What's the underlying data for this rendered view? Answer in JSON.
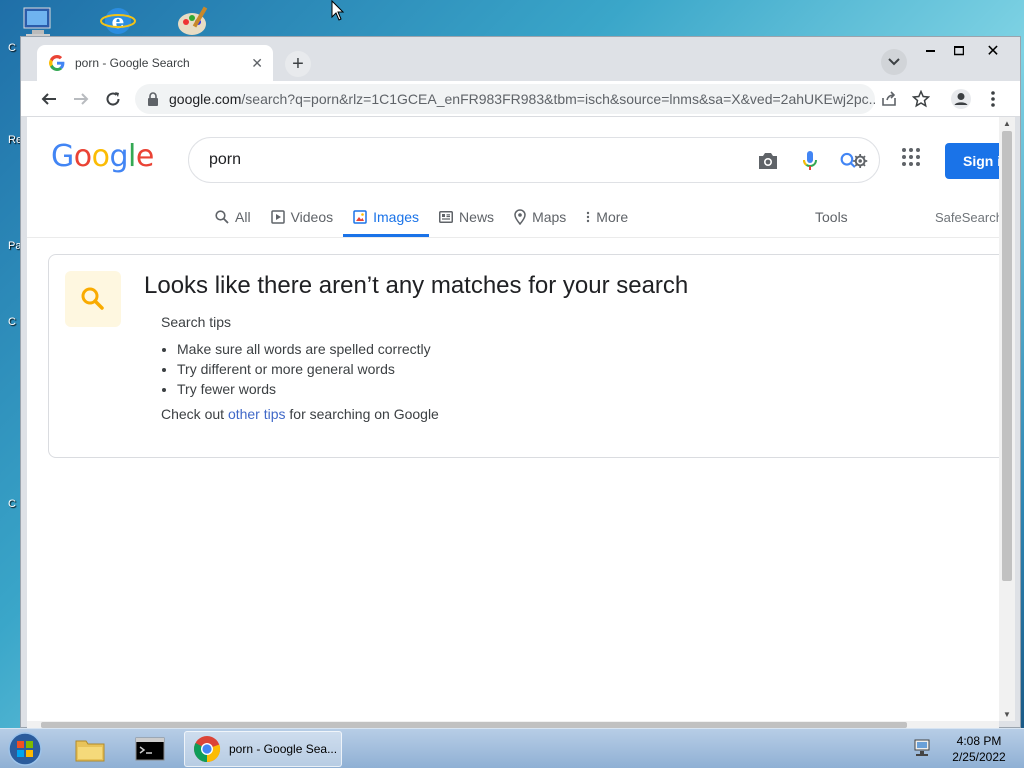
{
  "desktop": {
    "icons": [
      "computer-icon",
      "internet-explorer-icon",
      "paint-icon"
    ],
    "edge_labels": [
      "C",
      "Re",
      "Pa",
      "C",
      "C"
    ]
  },
  "browser": {
    "tab": {
      "title": "porn - Google Search",
      "favicon": "google-g-icon"
    },
    "url": {
      "host": "google.com",
      "path": "/search?q=porn&rlz=1C1GCEA_enFR983FR983&tbm=isch&source=lnms&sa=X&ved=2ahUKEwj2pc..."
    }
  },
  "google": {
    "logo_letters": [
      {
        "ch": "G",
        "color": "#4285F4"
      },
      {
        "ch": "o",
        "color": "#EA4335"
      },
      {
        "ch": "o",
        "color": "#FBBC05"
      },
      {
        "ch": "g",
        "color": "#4285F4"
      },
      {
        "ch": "l",
        "color": "#34A853"
      },
      {
        "ch": "e",
        "color": "#EA4335"
      }
    ],
    "query": "porn",
    "signin_label": "Sign i",
    "nav": {
      "all": "All",
      "videos": "Videos",
      "images": "Images",
      "news": "News",
      "maps": "Maps",
      "more": "More",
      "active": "images"
    },
    "tools_label": "Tools",
    "safesearch_label": "SafeSearch",
    "no_results": {
      "title": "Looks like there aren’t any matches for your search",
      "tips_heading": "Search tips",
      "tips": [
        "Make sure all words are spelled correctly",
        "Try different or more general words",
        "Try fewer words"
      ],
      "other_prefix": "Check out ",
      "other_link": "other tips",
      "other_suffix": " for searching on Google"
    }
  },
  "taskbar": {
    "chrome_label": "porn - Google Sea...",
    "time": "4:08 PM",
    "date": "2/25/2022"
  },
  "colors": {
    "accent": "#1a73e8",
    "link": "#4169c8",
    "tip_icon_bg": "#fef7e0",
    "tip_icon": "#f9ab00"
  }
}
